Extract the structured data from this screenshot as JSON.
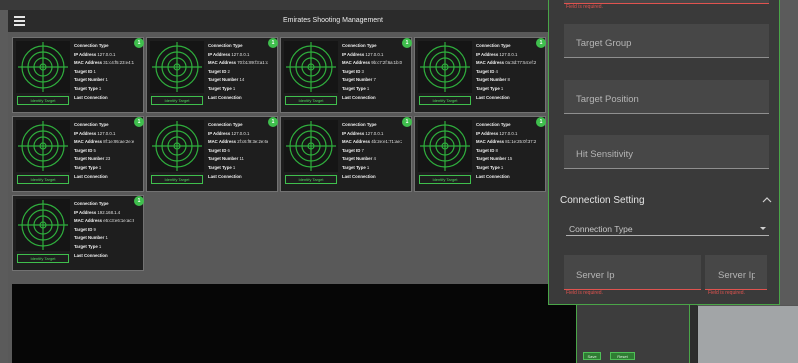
{
  "theme": {
    "accent": "#3fbf4d",
    "error": "#e0534f"
  },
  "app": {
    "title": "Emirates Shooting Management"
  },
  "card_labels": {
    "connection_type": "Connection Type",
    "ip": "IP Address",
    "mac": "MAC Address",
    "id": "Target ID",
    "number": "Target Number",
    "type": "Target Type",
    "last_connection": "Last Connection",
    "identify": "Identify Target"
  },
  "targets": [
    {
      "badge": "1",
      "ip": "127.0.0.1",
      "mac": "31:c4:f5:23:e4:1a",
      "id": "1",
      "number": "1",
      "type": "1"
    },
    {
      "badge": "1",
      "ip": "127.0.0.1",
      "mac": "70:b1:89:f3:a1:c2",
      "id": "2",
      "number": "14",
      "type": "1"
    },
    {
      "badge": "1",
      "ip": "127.0.0.1",
      "mac": "9b:c7:2f:6a:1b:0e",
      "id": "3",
      "number": "7",
      "type": "1"
    },
    {
      "badge": "1",
      "ip": "127.0.0.1",
      "mac": "0a:3d:77:54:ef:2f",
      "id": "4",
      "number": "8",
      "type": "1"
    },
    {
      "badge": "1",
      "ip": "127.0.0.1",
      "mac": "8f:1e:95:ae:2e:e7",
      "id": "5",
      "number": "23",
      "type": "1"
    },
    {
      "badge": "1",
      "ip": "127.0.0.1",
      "mac": "2f:c6:f9:3e:2e:6e",
      "id": "6",
      "number": "11",
      "type": "1"
    },
    {
      "badge": "1",
      "ip": "127.0.0.1",
      "mac": "4b:2e:e1:71:ae:29",
      "id": "7",
      "number": "4",
      "type": "1"
    },
    {
      "badge": "1",
      "ip": "127.0.0.1",
      "mac": "81:1e:25:0f:37:28",
      "id": "8",
      "number": "15",
      "type": "1"
    },
    {
      "badge": "1",
      "ip": "192.168.1.4",
      "mac": "e5:c3:e6:1e:ac:87",
      "id": "9",
      "number": "1",
      "type": "1"
    }
  ],
  "panel": {
    "top_field_error": "Field is required.",
    "fields": [
      {
        "label": "Target Group"
      },
      {
        "label": "Target Position"
      },
      {
        "label": "Hit Sensitivity"
      }
    ],
    "connection": {
      "title": "Connection Setting",
      "type_placeholder": "Connection Type",
      "server_ip": [
        {
          "label": "Server Ip",
          "error": "Field is required."
        },
        {
          "label": "Server Ip",
          "error": "Field is required."
        }
      ]
    }
  },
  "actions": {
    "save": "Save",
    "reset": "Reset"
  }
}
